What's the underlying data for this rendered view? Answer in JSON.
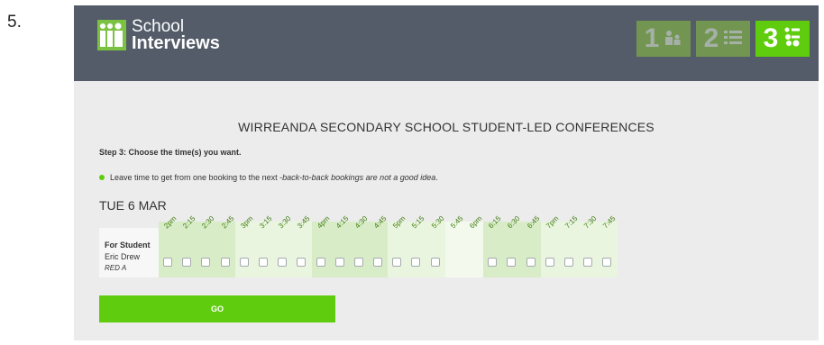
{
  "page": {
    "step_marker": "5."
  },
  "header": {
    "brand_line1": "School",
    "brand_line2": "Interviews",
    "steps": [
      {
        "number": "1",
        "icon": "people-icon",
        "state": "inactive"
      },
      {
        "number": "2",
        "icon": "list-icon",
        "state": "inactive"
      },
      {
        "number": "3",
        "icon": "schedule-icon",
        "state": "active"
      }
    ]
  },
  "main": {
    "title": "WIRREANDA SECONDARY SCHOOL STUDENT-LED CONFERENCES",
    "instruction": "Step 3: Choose the time(s) you want.",
    "tip_plain": "Leave time to get from one booking to the next - ",
    "tip_italic": "back-to-back bookings are not a good idea",
    "tip_end": ".",
    "date": "TUE 6 MAR",
    "student_label": "For Student",
    "student_name": "Eric Drew",
    "student_group": "RED A",
    "times": [
      "2pm",
      "2:15",
      "2:30",
      "2:45",
      "3pm",
      "3:15",
      "3:30",
      "3:45",
      "4pm",
      "4:15",
      "4:30",
      "4:45",
      "5pm",
      "5:15",
      "5:30",
      "5:45",
      "6pm",
      "6:15",
      "6:30",
      "6:45",
      "7pm",
      "7:15",
      "7:30",
      "7:45"
    ],
    "available": [
      true,
      true,
      true,
      true,
      true,
      true,
      true,
      true,
      true,
      true,
      true,
      true,
      true,
      true,
      true,
      false,
      false,
      true,
      true,
      true,
      true,
      true,
      true,
      true
    ],
    "go_label": "GO"
  },
  "colors": {
    "header_bg": "#535c68",
    "accent_green": "#5fcc0e",
    "page_bg": "#ececec"
  }
}
